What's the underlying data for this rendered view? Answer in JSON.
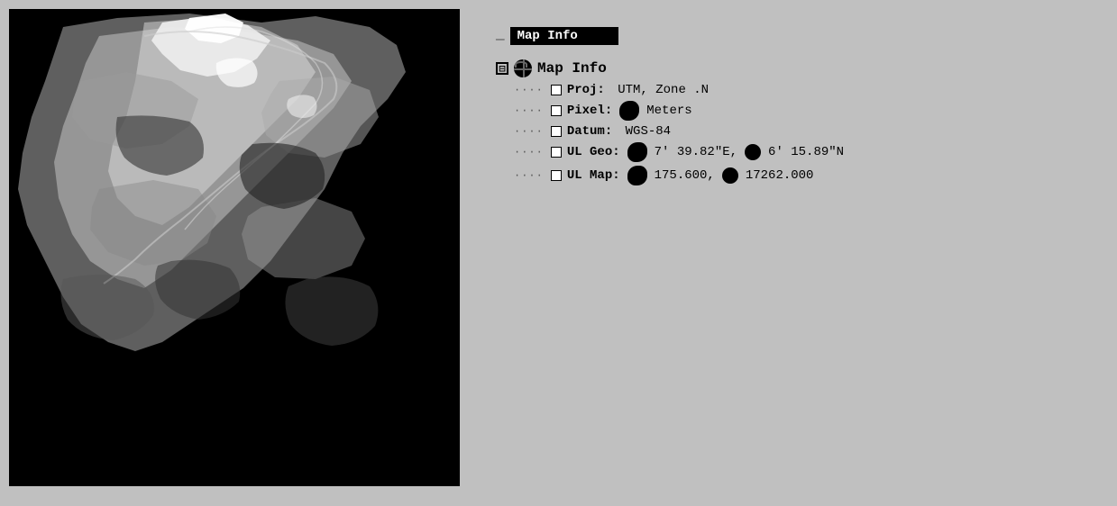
{
  "title_bar": "Map Info",
  "title_bar_label": "Map Info",
  "header_label": "— ■■■■■■■",
  "tree": {
    "root_label": "Map Info",
    "toggle_symbol": "⊟",
    "items": [
      {
        "label": "Proj:",
        "value": "UTM, Zone .N",
        "has_blob": false
      },
      {
        "label": "Pixel:",
        "value": "Meters",
        "has_blob": true
      },
      {
        "label": "Datum:",
        "value": "WGS-84",
        "has_blob": false
      },
      {
        "label": "UL Geo:",
        "value": "7' 39.82\"E,  6' 15.89\"N",
        "has_blob": true,
        "blob_positions": [
          0,
          1
        ]
      },
      {
        "label": "UL Map:",
        "value": "175.600,  17262.000",
        "has_blob": true,
        "blob_positions": [
          0,
          1
        ]
      }
    ]
  },
  "map": {
    "description": "Satellite terrain map showing mountainous region",
    "bg_color": "#000000"
  }
}
